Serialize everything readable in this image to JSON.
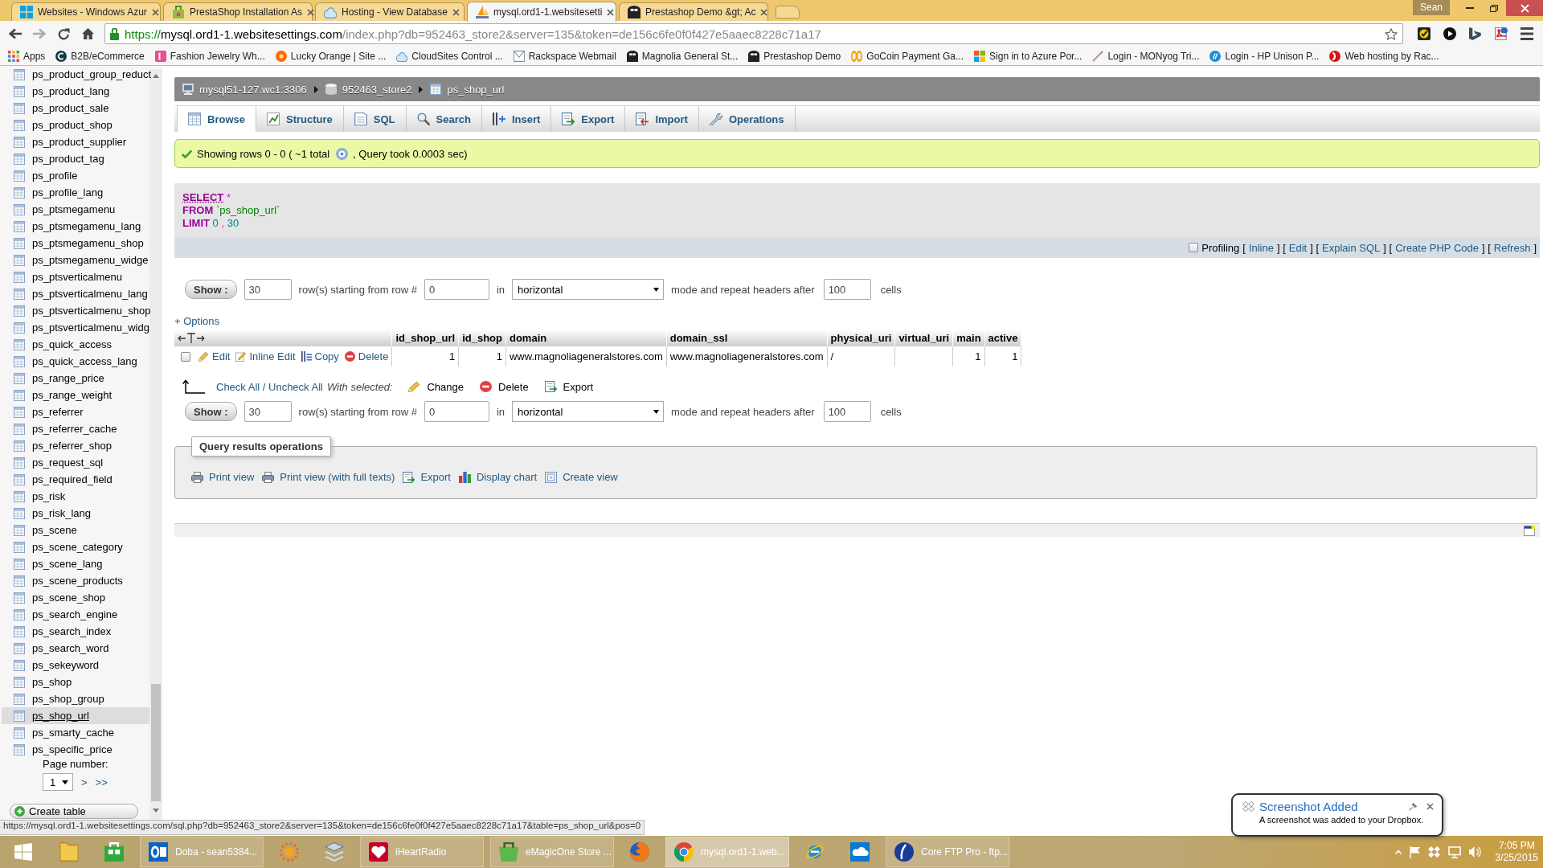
{
  "browser": {
    "tabs": [
      {
        "title": "Websites - Windows Azur",
        "selected": false
      },
      {
        "title": "PrestaShop Installation As",
        "selected": false
      },
      {
        "title": "Hosting - View Database",
        "selected": false
      },
      {
        "title": "mysql.ord1-1.websitesetti",
        "selected": true
      },
      {
        "title": "Prestashop Demo &gt; Ac",
        "selected": false
      }
    ],
    "profile": "Sean",
    "address": {
      "scheme": "https://",
      "host": "mysql.ord1-1.websitesettings.com",
      "path": "/index.php?db=952463_store2&server=135&token=de156c6fe0f0f427e5aaec8228c71a17"
    },
    "bookmarks": [
      "Apps",
      "B2B/eCommerce",
      "Fashion Jewelry Wh...",
      "Lucky Orange | Site ...",
      "CloudSites Control ...",
      "Rackspace Webmail",
      "Magnolia General St...",
      "Prestashop Demo",
      "GoCoin Payment Ga...",
      "Sign in to Azure Por...",
      "Login - MONyog Tri...",
      "Login - HP Unison P...",
      "Web hosting by Rac..."
    ]
  },
  "sidebar": {
    "tables": [
      {
        "name": "ps_product_group_reduct",
        "selected": false
      },
      {
        "name": "ps_product_lang",
        "selected": false
      },
      {
        "name": "ps_product_sale",
        "selected": false
      },
      {
        "name": "ps_product_shop",
        "selected": false
      },
      {
        "name": "ps_product_supplier",
        "selected": false
      },
      {
        "name": "ps_product_tag",
        "selected": false
      },
      {
        "name": "ps_profile",
        "selected": false
      },
      {
        "name": "ps_profile_lang",
        "selected": false
      },
      {
        "name": "ps_ptsmegamenu",
        "selected": false
      },
      {
        "name": "ps_ptsmegamenu_lang",
        "selected": false
      },
      {
        "name": "ps_ptsmegamenu_shop",
        "selected": false
      },
      {
        "name": "ps_ptsmegamenu_widge",
        "selected": false
      },
      {
        "name": "ps_ptsverticalmenu",
        "selected": false
      },
      {
        "name": "ps_ptsverticalmenu_lang",
        "selected": false
      },
      {
        "name": "ps_ptsverticalmenu_shop",
        "selected": false
      },
      {
        "name": "ps_ptsverticalmenu_widg",
        "selected": false
      },
      {
        "name": "ps_quick_access",
        "selected": false
      },
      {
        "name": "ps_quick_access_lang",
        "selected": false
      },
      {
        "name": "ps_range_price",
        "selected": false
      },
      {
        "name": "ps_range_weight",
        "selected": false
      },
      {
        "name": "ps_referrer",
        "selected": false
      },
      {
        "name": "ps_referrer_cache",
        "selected": false
      },
      {
        "name": "ps_referrer_shop",
        "selected": false
      },
      {
        "name": "ps_request_sql",
        "selected": false
      },
      {
        "name": "ps_required_field",
        "selected": false
      },
      {
        "name": "ps_risk",
        "selected": false
      },
      {
        "name": "ps_risk_lang",
        "selected": false
      },
      {
        "name": "ps_scene",
        "selected": false
      },
      {
        "name": "ps_scene_category",
        "selected": false
      },
      {
        "name": "ps_scene_lang",
        "selected": false
      },
      {
        "name": "ps_scene_products",
        "selected": false
      },
      {
        "name": "ps_scene_shop",
        "selected": false
      },
      {
        "name": "ps_search_engine",
        "selected": false
      },
      {
        "name": "ps_search_index",
        "selected": false
      },
      {
        "name": "ps_search_word",
        "selected": false
      },
      {
        "name": "ps_sekeyword",
        "selected": false
      },
      {
        "name": "ps_shop",
        "selected": false
      },
      {
        "name": "ps_shop_group",
        "selected": false
      },
      {
        "name": "ps_shop_url",
        "selected": true
      },
      {
        "name": "ps_smarty_cache",
        "selected": false
      },
      {
        "name": "ps_specific_price",
        "selected": false
      }
    ],
    "page_label": "Page number:",
    "page_select": "1",
    "page_links": [
      ">",
      ">>"
    ],
    "create_table": "Create table"
  },
  "breadcrumb": [
    "mysql51-127.wc1:3306",
    "952463_store2",
    "ps_shop_url"
  ],
  "tabs": [
    {
      "label": "Browse",
      "selected": true
    },
    {
      "label": "Structure",
      "selected": false
    },
    {
      "label": "SQL",
      "selected": false
    },
    {
      "label": "Search",
      "selected": false
    },
    {
      "label": "Insert",
      "selected": false
    },
    {
      "label": "Export",
      "selected": false
    },
    {
      "label": "Import",
      "selected": false
    },
    {
      "label": "Operations",
      "selected": false
    }
  ],
  "message": {
    "before": "Showing rows 0 - 0 ( ~1 total",
    "after": ", Query took 0.0003 sec)"
  },
  "sql": [
    [
      {
        "kind": "doc_keyword",
        "text": "SELECT"
      },
      {
        "kind": "operator",
        "text": "*"
      }
    ],
    [
      {
        "kind": "keyword",
        "text": "FROM"
      },
      {
        "kind": "string",
        "text": "`ps_shop_url`"
      }
    ],
    [
      {
        "kind": "keyword",
        "text": "LIMIT"
      },
      {
        "kind": "number",
        "text": "0"
      },
      {
        "kind": "operator",
        "text": ","
      },
      {
        "kind": "number",
        "text": "30"
      }
    ]
  ],
  "sql_tools": {
    "profiling": {
      "label": "Profiling",
      "checked": false
    },
    "items": [
      {
        "kind": "text",
        "text": "["
      },
      {
        "kind": "link",
        "text": "Inline"
      },
      {
        "kind": "text",
        "text": "] ["
      },
      {
        "kind": "link",
        "text": "Edit"
      },
      {
        "kind": "text",
        "text": "] ["
      },
      {
        "kind": "link",
        "text": "Explain SQL"
      },
      {
        "kind": "text",
        "text": "] ["
      },
      {
        "kind": "link",
        "text": "Create PHP Code"
      },
      {
        "kind": "text",
        "text": "] ["
      },
      {
        "kind": "link",
        "text": "Refresh"
      },
      {
        "kind": "text",
        "text": "]"
      }
    ]
  },
  "navigation_top": {
    "button": "Show :",
    "rows": "30",
    "label_rows": "row(s) starting from row #",
    "start": "0",
    "label_in": "in",
    "mode": "horizontal",
    "label_mode": "mode and repeat headers after",
    "repeat": "100",
    "label_cells": "cells"
  },
  "options_link": "+ Options",
  "results_table": {
    "columns": [
      "id_shop_url",
      "id_shop",
      "domain",
      "domain_ssl",
      "physical_uri",
      "virtual_uri",
      "main",
      "active"
    ],
    "rows": [
      {
        "checked": false,
        "actions": [
          "Edit",
          "Inline Edit",
          "Copy",
          "Delete"
        ],
        "cells": [
          {
            "kind": "number",
            "text": "1"
          },
          {
            "kind": "number",
            "text": "1"
          },
          {
            "kind": "text",
            "text": "www.magnoliageneralstores.com"
          },
          {
            "kind": "text",
            "text": "www.magnoliageneralstores.com"
          },
          {
            "kind": "text",
            "text": "/"
          },
          {
            "kind": "empty"
          },
          {
            "kind": "number",
            "text": "1"
          },
          {
            "kind": "number",
            "text": "1"
          }
        ]
      }
    ]
  },
  "bulk_actions": {
    "check_all": "Check All / Uncheck All",
    "with_selected": "With selected:",
    "actions": [
      "Change",
      "Delete",
      "Export"
    ]
  },
  "navigation_bottom": {
    "button": "Show :",
    "rows": "30",
    "label_rows": "row(s) starting from row #",
    "start": "0",
    "label_in": "in",
    "mode": "horizontal",
    "label_mode": "mode and repeat headers after",
    "repeat": "100",
    "label_cells": "cells"
  },
  "query_results_operations": {
    "legend": "Query results operations",
    "links": [
      "Print view",
      "Print view (with full texts)",
      "Export",
      "Display chart",
      "Create view"
    ]
  },
  "status_url": "https://mysql.ord1-1.websitesettings.com/sql.php?db=952463_store2&server=135&token=de156c6fe0f0f427e5aaec8228c71a17&table=ps_shop_url&pos=0",
  "taskbar": {
    "apps": [
      {
        "selected": false
      },
      {
        "selected": false
      },
      {
        "label": "Doba - sean5384...",
        "selected": false
      },
      {
        "selected": false
      },
      {
        "selected": false
      },
      {
        "label": "iHeartRadio",
        "selected": false
      },
      {
        "label": "eMagicOne Store ...",
        "selected": false
      },
      {
        "selected": false
      },
      {
        "label": "mysql.ord1-1.web...",
        "selected": true
      },
      {
        "selected": false
      },
      {
        "selected": false
      },
      {
        "label": "Core FTP Pro - ftp...",
        "selected": false
      }
    ],
    "time": "7:05 PM",
    "date": "3/25/2015"
  },
  "notification": {
    "title": "Screenshot Added",
    "body": "A screenshot was added to your Dropbox."
  }
}
